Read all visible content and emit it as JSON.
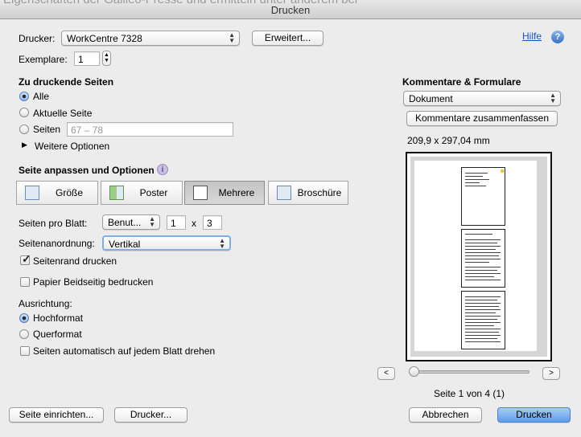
{
  "window": {
    "title": "Drucken",
    "background_text": "Eigenschaften der Galileo-Presse und ermitteln unter anderem bei"
  },
  "printer": {
    "label": "Drucker:",
    "value": "WorkCentre 7328",
    "advanced_button": "Erweitert...",
    "help_link": "Hilfe",
    "help_icon_glyph": "?"
  },
  "copies": {
    "label": "Exemplare:",
    "value": "1"
  },
  "pages": {
    "heading": "Zu druckende Seiten",
    "options": [
      "Alle",
      "Aktuelle Seite",
      "Seiten"
    ],
    "selected": "Alle",
    "range_placeholder": "67 – 78",
    "more_options": "Weitere Optionen"
  },
  "fit": {
    "heading": "Seite anpassen und Optionen",
    "info_glyph": "i",
    "modes": [
      {
        "label": "Größe",
        "icon": "resize-icon"
      },
      {
        "label": "Poster",
        "icon": "poster-icon"
      },
      {
        "label": "Mehrere",
        "icon": "multiple-pages-icon"
      },
      {
        "label": "Broschüre",
        "icon": "booklet-icon"
      }
    ],
    "selected_mode": "Mehrere"
  },
  "multiple": {
    "pages_per_sheet_label": "Seiten pro Blatt:",
    "pages_per_sheet_value": "Benut...",
    "cols": "1",
    "times": "x",
    "rows": "3",
    "order_label": "Seitenanordnung:",
    "order_value": "Vertikal",
    "border_label": "Seitenrand drucken",
    "border_checked": true,
    "duplex_label": "Papier Beidseitig bedrucken",
    "duplex_checked": false
  },
  "orientation": {
    "label": "Ausrichtung:",
    "options": [
      "Hochformat",
      "Querformat"
    ],
    "selected": "Hochformat",
    "autorotate_label": "Seiten automatisch auf jedem Blatt drehen",
    "autorotate_checked": false
  },
  "comments": {
    "heading": "Kommentare & Formulare",
    "value": "Dokument",
    "summarize_button": "Kommentare zusammenfassen",
    "size": "209,9 x 297,04 mm"
  },
  "preview": {
    "prev_glyph": "<",
    "next_glyph": ">",
    "slider_position": 0,
    "page_status": "Seite 1 von 4 (1)"
  },
  "footer": {
    "page_setup_button": "Seite einrichten...",
    "printer_button": "Drucker...",
    "cancel_button": "Abbrechen",
    "print_button": "Drucken"
  },
  "colors": {
    "accent": "#5d9ceb",
    "link": "#1a4fd0",
    "dialog_bg": "#ececec"
  }
}
